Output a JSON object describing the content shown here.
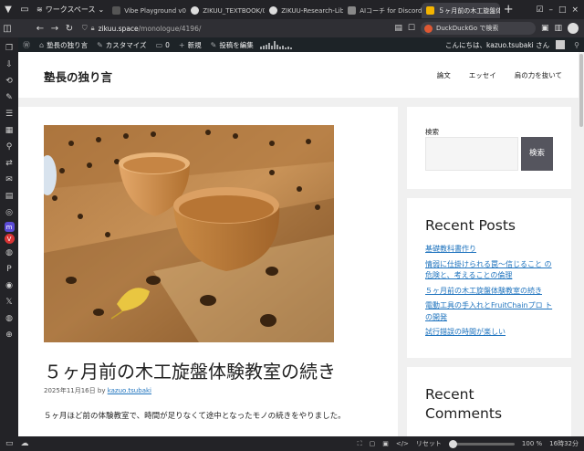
{
  "browser": {
    "workspace_label": "ワークスペース",
    "tabs": [
      {
        "label": "Vibe Playground v0.2",
        "color": "#555555",
        "active": false
      },
      {
        "label": "ZIKUU_TEXTBOOK/01...",
        "color": "#dddddd",
        "active": false
      },
      {
        "label": "ZIKUU-Research-Librar...",
        "color": "#dddddd",
        "active": false
      },
      {
        "label": "AIコーチ for Discord Da...",
        "color": "#888888",
        "active": false
      },
      {
        "label": "５ヶ月前の木工旋盤体験...",
        "color": "#f4b400",
        "active": true
      }
    ],
    "url_domain": "zikuu.space",
    "url_path": "/monologue/4196/",
    "search_placeholder": "DuckDuckGo で検索"
  },
  "adminbar": {
    "site_name": "塾長の独り言",
    "customize": "カスタマイズ",
    "comments_count": "0",
    "new": "新規",
    "edit_post": "投稿を編集",
    "greeting": "こんにちは、kazuo.tsubaki さん"
  },
  "site": {
    "title": "塾長の独り言",
    "nav": [
      "論文",
      "エッセイ",
      "肩の力を抜いて"
    ]
  },
  "post": {
    "title": "５ヶ月前の木工旋盤体験教室の続き",
    "date": "2025年11月16日",
    "by": "by",
    "author": "kazuo.tsubaki",
    "body": "５ヶ月ほど前の体験教室で、時間が足りなくて途中となったモノの続きをやりました。"
  },
  "sidebar": {
    "search_label": "検索",
    "search_button": "検索",
    "recent_posts_heading": "Recent Posts",
    "recent_posts": [
      "基礎教科書作り",
      "情弱に仕掛けられる罠〜信じること の危険と、考えることの倫理",
      "５ヶ月前の木工旋盤体験教室の続き",
      "電動工具の手入れとFruitChainプロ ト の開発",
      "試行錯誤の時間が楽しい"
    ],
    "recent_comments_heading": "Recent Comments"
  },
  "statusbar": {
    "reset_label": "リセット",
    "zoom": "100 %",
    "time": "16時32分"
  }
}
